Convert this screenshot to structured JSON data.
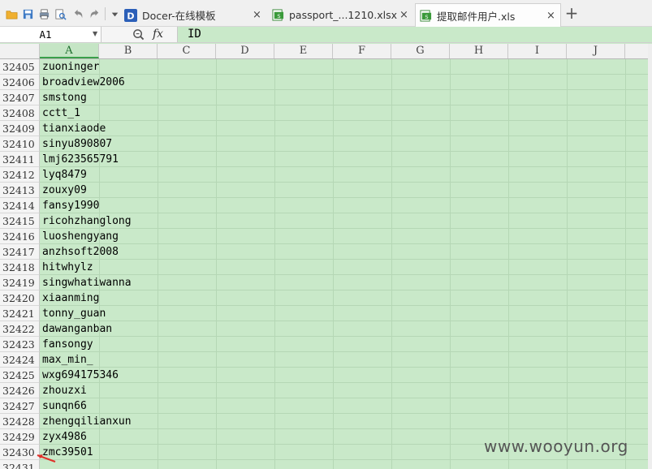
{
  "tabs": [
    {
      "label": "Docer-在线模板",
      "icon": "docer-icon"
    },
    {
      "label": "passport_...1210.xlsx",
      "icon": "spreadsheet-icon"
    },
    {
      "label": "提取邮件用户.xls",
      "icon": "spreadsheet-icon",
      "active": true
    }
  ],
  "tab_close_glyph": "×",
  "tab_add_glyph": "+",
  "formula_bar": {
    "cell_reference": "A1",
    "fx_label": "fx",
    "formula_value": "ID"
  },
  "columns": [
    "A",
    "B",
    "C",
    "D",
    "E",
    "F",
    "G",
    "H",
    "I",
    "J"
  ],
  "selected_column": "A",
  "rows": [
    {
      "num": "32405",
      "a": "zuoninger"
    },
    {
      "num": "32406",
      "a": "broadview2006"
    },
    {
      "num": "32407",
      "a": "smstong"
    },
    {
      "num": "32408",
      "a": "cctt_1"
    },
    {
      "num": "32409",
      "a": "tianxiaode"
    },
    {
      "num": "32410",
      "a": "sinyu890807"
    },
    {
      "num": "32411",
      "a": "lmj623565791"
    },
    {
      "num": "32412",
      "a": "lyq8479"
    },
    {
      "num": "32413",
      "a": "zouxy09"
    },
    {
      "num": "32414",
      "a": "fansy1990"
    },
    {
      "num": "32415",
      "a": "ricohzhanglong"
    },
    {
      "num": "32416",
      "a": "luoshengyang"
    },
    {
      "num": "32417",
      "a": "anzhsoft2008"
    },
    {
      "num": "32418",
      "a": "hitwhylz"
    },
    {
      "num": "32419",
      "a": "singwhatiwanna"
    },
    {
      "num": "32420",
      "a": "xiaanming"
    },
    {
      "num": "32421",
      "a": "tonny_guan"
    },
    {
      "num": "32422",
      "a": "dawanganban"
    },
    {
      "num": "32423",
      "a": "fansongy"
    },
    {
      "num": "32424",
      "a": "max_min_"
    },
    {
      "num": "32425",
      "a": "wxg694175346"
    },
    {
      "num": "32426",
      "a": "zhouzxi"
    },
    {
      "num": "32427",
      "a": "sunqn66"
    },
    {
      "num": "32428",
      "a": "zhengqilianxun"
    },
    {
      "num": "32429",
      "a": "zyx4986"
    },
    {
      "num": "32430",
      "a": "zmc39501"
    },
    {
      "num": "32431",
      "a": ""
    }
  ],
  "watermark": "www.wooyun.org",
  "colors": {
    "grid_background": "#c9e9c9",
    "grid_lines": "#b5d7b5",
    "selected_header": "#c5e5c5",
    "annotation_arrow": "#e0302a"
  }
}
